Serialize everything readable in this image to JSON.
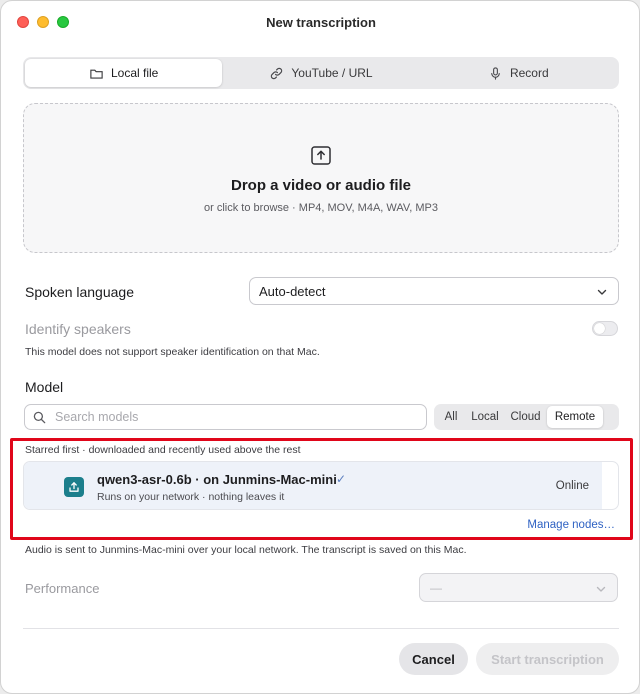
{
  "window": {
    "title": "New transcription"
  },
  "tabs": [
    {
      "label": "Local file",
      "icon": "folder-icon",
      "active": true
    },
    {
      "label": "YouTube / URL",
      "icon": "link-icon",
      "active": false
    },
    {
      "label": "Record",
      "icon": "microphone-icon",
      "active": false
    }
  ],
  "dropzone": {
    "title": "Drop a video or audio file",
    "subtitle": "or click to browse · MP4, MOV, M4A, WAV, MP3",
    "icon": "upload-icon"
  },
  "language": {
    "label": "Spoken language",
    "value": "Auto-detect"
  },
  "speakers": {
    "label": "Identify speakers",
    "enabled": false,
    "note": "This model does not support speaker identification on that Mac."
  },
  "model": {
    "label": "Model",
    "search_placeholder": "Search models",
    "filters": [
      {
        "label": "All",
        "active": false
      },
      {
        "label": "Local",
        "active": false
      },
      {
        "label": "Cloud",
        "active": false
      },
      {
        "label": "Remote",
        "active": true
      }
    ],
    "hint": "Starred first · downloaded and recently used above the rest",
    "items": [
      {
        "name": "qwen3-asr-0.6b · on Junmins-Mac-mini",
        "check": "✓",
        "subtitle": "Runs on your network · nothing leaves it",
        "status": "Online",
        "icon": "remote-share-icon"
      }
    ],
    "manage_link": "Manage nodes…",
    "footnote": "Audio is sent to Junmins-Mac-mini over your local network. The transcript is saved on this Mac."
  },
  "performance": {
    "label": "Performance",
    "value": "—"
  },
  "buttons": {
    "cancel": "Cancel",
    "start": "Start transcription"
  },
  "colors": {
    "accent": "#2f62c3",
    "model_icon_bg": "#1c7f8c",
    "annotation_red": "#e0061a"
  }
}
